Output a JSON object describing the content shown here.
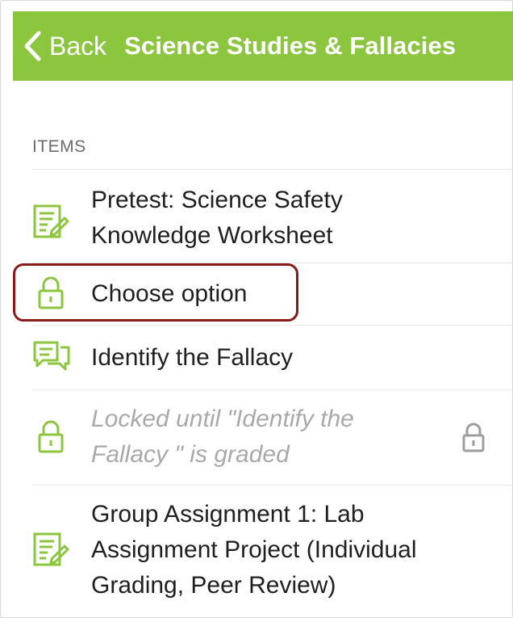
{
  "colors": {
    "accent": "#8cc63f",
    "highlight": "#8b1a1a",
    "locked_text": "#a9a9a9",
    "gray_icon": "#9e9e9e"
  },
  "nav": {
    "back_label": "Back",
    "title": "Science Studies & Fallacies"
  },
  "section": {
    "label": "ITEMS"
  },
  "items": [
    {
      "icon": "assignment-icon",
      "lines": [
        "Pretest: Science Safety",
        "Knowledge Worksheet"
      ]
    },
    {
      "icon": "lock-icon",
      "lines": [
        "Choose option"
      ]
    },
    {
      "icon": "discussion-icon",
      "lines": [
        "Identify the Fallacy"
      ]
    },
    {
      "icon": "lock-icon",
      "lines": [
        "Locked until \"Identify the",
        "Fallacy \" is graded"
      ],
      "trailing_icon": "lock-icon"
    },
    {
      "icon": "assignment-icon",
      "lines": [
        "Group Assignment 1: Lab",
        "Assignment Project (Individual",
        "Grading, Peer Review)"
      ]
    }
  ]
}
